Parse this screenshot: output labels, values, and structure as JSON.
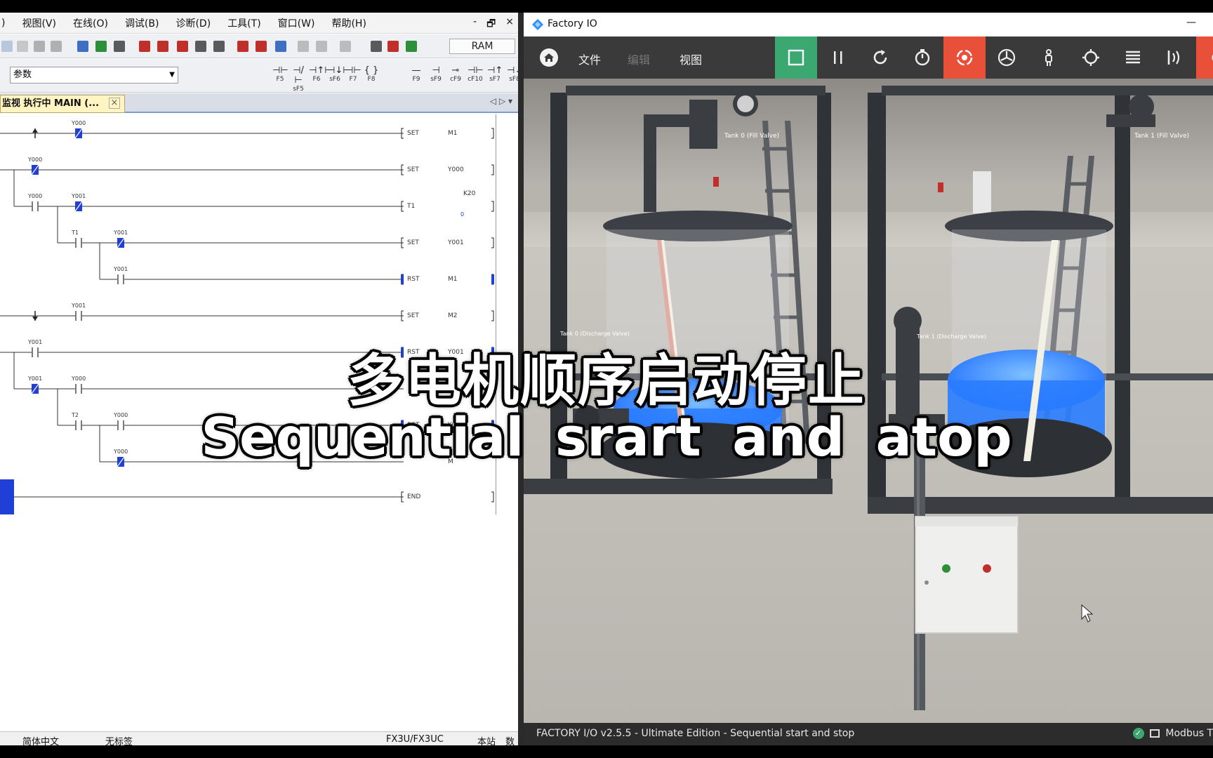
{
  "gx": {
    "menus": [
      ")",
      "视图(V)",
      "在线(O)",
      "调试(B)",
      "诊断(D)",
      "工具(T)",
      "窗口(W)",
      "帮助(H)"
    ],
    "window_buttons": [
      "-",
      "🗗",
      "×"
    ],
    "ram_label": "RAM",
    "param_value": "参数",
    "fkeys": [
      {
        "glyph": "⊣⊢",
        "label": "F5"
      },
      {
        "glyph": "⊣/⊢",
        "label": "sF5"
      },
      {
        "glyph": "⊣↑⊢",
        "label": "F6"
      },
      {
        "glyph": "⊣↓⊢",
        "label": "sF6"
      },
      {
        "glyph": "⊣⊢",
        "label": "F7"
      },
      {
        "glyph": "{ }",
        "label": "F8"
      },
      {
        "glyph": "—",
        "label": "F9"
      },
      {
        "glyph": "⊣",
        "label": "sF9"
      },
      {
        "glyph": "⊸",
        "label": "cF9"
      },
      {
        "glyph": "⊣⊢",
        "label": "cF10"
      },
      {
        "glyph": "⊣↑",
        "label": "sF7"
      },
      {
        "glyph": "⊣↓",
        "label": "sF8"
      }
    ],
    "tab_label": "监视 执行中 MAIN (...",
    "tab_close": "×",
    "tab_nav": "◁ ▷ ▾",
    "rungs": [
      {
        "contacts": [
          {
            "label": "Y000",
            "kind": "active"
          }
        ],
        "coil": "SET",
        "operand": "M1",
        "start": "up"
      },
      {
        "contacts": [
          {
            "label": "Y000",
            "kind": "active"
          }
        ],
        "coil": "SET",
        "operand": "Y000"
      },
      {
        "contacts": [
          {
            "label": "Y000",
            "kind": "open"
          },
          {
            "label": "Y001",
            "kind": "active"
          }
        ],
        "coil": "T1",
        "operand": "K20",
        "operand2": "0",
        "timer": true
      },
      {
        "contacts": [
          {
            "label": "T1",
            "kind": "open"
          },
          {
            "label": "Y001",
            "kind": "active"
          }
        ],
        "coil": "SET",
        "operand": "Y001"
      },
      {
        "contacts": [
          {
            "label": "Y001",
            "kind": "open"
          }
        ],
        "coil": "RST",
        "operand": "M1",
        "hl": true
      },
      {
        "contacts": [
          {
            "label": "Y001",
            "kind": "open"
          }
        ],
        "coil": "SET",
        "operand": "M2",
        "start": "down"
      },
      {
        "contacts": [
          {
            "label": "Y001",
            "kind": "open"
          }
        ],
        "coil": "RST",
        "operand": "Y001",
        "hl": true
      },
      {
        "contacts": [
          {
            "label": "Y001",
            "kind": "active"
          },
          {
            "label": "Y000",
            "kind": "open"
          }
        ],
        "coil": "",
        "operand": ""
      },
      {
        "contacts": [
          {
            "label": "T2",
            "kind": "open"
          },
          {
            "label": "Y000",
            "kind": "open"
          }
        ],
        "coil": "RST",
        "operand": "Y000",
        "hl": true
      },
      {
        "contacts": [
          {
            "label": "Y000",
            "kind": "active"
          }
        ],
        "coil": "",
        "operand": "M"
      },
      {
        "contacts": [],
        "coil": "END",
        "operand": ""
      }
    ],
    "status": {
      "lang": "简体中文",
      "label": "无标签",
      "cpu": "FX3U/FX3UC",
      "station": "本站",
      "extra": "数"
    }
  },
  "fio": {
    "title": "Factory IO",
    "menu": [
      "文件",
      "编辑",
      "视图"
    ],
    "buttons": [
      "stop",
      "pause",
      "reset",
      "timer",
      "camera-orbit",
      "camera-fly",
      "camera-first-person",
      "target",
      "list",
      "sensors",
      "settings"
    ],
    "tank_labels": [
      "Tank 0 (Fill Valve)",
      "Tank 1 (Fill Valve)",
      "Tank 0 (Discharge Valve)",
      "Tank 1 (Discharge Valve)"
    ],
    "status_left": "FACTORY I/O v2.5.5 - Ultimate Edition - Sequential start and stop",
    "status_right": "Modbus T"
  },
  "subtitle": {
    "cn": "多电机顺序启动停止",
    "en": "Sequential srart and atop"
  },
  "colors": {
    "active": "#1f3fd6",
    "accent_orange": "#e8503a",
    "active_green": "#3aa870",
    "water": "#2f8fff"
  }
}
